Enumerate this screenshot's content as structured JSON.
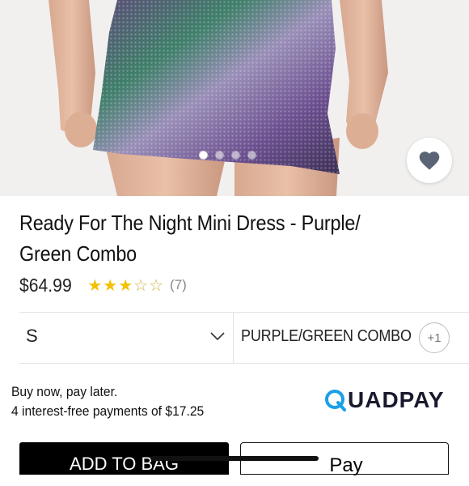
{
  "product": {
    "title": "Ready For The Night Mini Dress - Purple/ Green Combo",
    "price": "$64.99",
    "rating_stars": 3,
    "rating_max": 5,
    "review_count": "(7)"
  },
  "gallery": {
    "image_count": 4,
    "active_index": 0,
    "favorite_icon": "heart-icon"
  },
  "selectors": {
    "size_value": "S",
    "size_icon": "chevron-down-icon",
    "color_value": "PURPLE/GREEN COMBO",
    "more_colors": "+1"
  },
  "payment": {
    "line1": "Buy now, pay later.",
    "line2": "4 interest-free payments of $17.25",
    "provider": "QUADPAY"
  },
  "actions": {
    "add_to_bag": "ADD TO BAG",
    "apple_pay": "Pay"
  },
  "colors": {
    "accent_black": "#000000",
    "star_gold": "#f2c100",
    "quadpay_blue": "#1aa0e6"
  }
}
